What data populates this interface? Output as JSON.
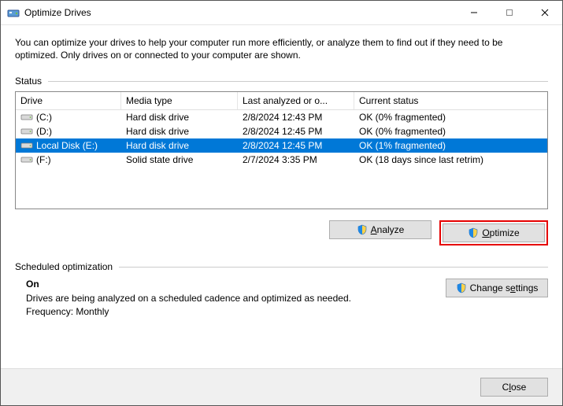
{
  "window": {
    "title": "Optimize Drives"
  },
  "description": "You can optimize your drives to help your computer run more efficiently, or analyze them to find out if they need to be optimized. Only drives on or connected to your computer are shown.",
  "status_label": "Status",
  "columns": {
    "drive": "Drive",
    "media": "Media type",
    "last": "Last analyzed or o...",
    "status": "Current status"
  },
  "rows": [
    {
      "drive": "(C:)",
      "media": "Hard disk drive",
      "last": "2/8/2024 12:43 PM",
      "status": "OK (0% fragmented)",
      "selected": false
    },
    {
      "drive": "(D:)",
      "media": "Hard disk drive",
      "last": "2/8/2024 12:45 PM",
      "status": "OK (0% fragmented)",
      "selected": false
    },
    {
      "drive": "Local Disk (E:)",
      "media": "Hard disk drive",
      "last": "2/8/2024 12:45 PM",
      "status": "OK (1% fragmented)",
      "selected": true
    },
    {
      "drive": "(F:)",
      "media": "Solid state drive",
      "last": "2/7/2024 3:35 PM",
      "status": "OK (18 days since last retrim)",
      "selected": false
    }
  ],
  "buttons": {
    "analyze_pre": "A",
    "analyze_post": "nalyze",
    "optimize_pre": "O",
    "optimize_post": "ptimize",
    "changesettings_pre": "Change s",
    "changesettings_u": "e",
    "changesettings_post": "ttings",
    "close_pre": "C",
    "close_u": "l",
    "close_post": "ose"
  },
  "schedule": {
    "label": "Scheduled optimization",
    "on": "On",
    "line1": "Drives are being analyzed on a scheduled cadence and optimized as needed.",
    "line2": "Frequency: Monthly"
  }
}
